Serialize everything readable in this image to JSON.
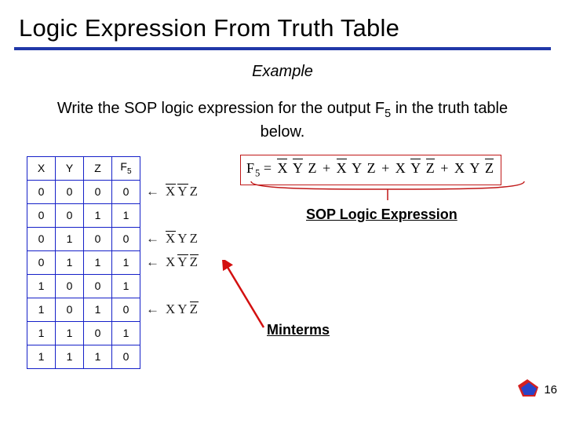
{
  "title": "Logic Expression From Truth Table",
  "example_label": "Example",
  "prompt_before": "Write the SOP logic expression for the output F",
  "prompt_sub": "5",
  "prompt_after": " in the truth table below.",
  "table": {
    "headers": [
      "X",
      "Y",
      "Z",
      "F5"
    ],
    "header_f_base": "F",
    "header_f_sub": "5",
    "rows": [
      [
        "0",
        "0",
        "0",
        "0"
      ],
      [
        "0",
        "0",
        "1",
        "1"
      ],
      [
        "0",
        "1",
        "0",
        "0"
      ],
      [
        "0",
        "1",
        "1",
        "1"
      ],
      [
        "1",
        "0",
        "0",
        "1"
      ],
      [
        "1",
        "0",
        "1",
        "0"
      ],
      [
        "1",
        "1",
        "0",
        "1"
      ],
      [
        "1",
        "1",
        "1",
        "0"
      ]
    ]
  },
  "minterms": {
    "arrow": "←",
    "vars": [
      "X",
      "Y",
      "Z"
    ],
    "items": [
      {
        "active": true,
        "bars": [
          true,
          true,
          false
        ]
      },
      {
        "active": false,
        "bars": []
      },
      {
        "active": true,
        "bars": [
          true,
          false,
          false
        ]
      },
      {
        "active": true,
        "bars": [
          false,
          true,
          true
        ]
      },
      {
        "active": false,
        "bars": []
      },
      {
        "active": true,
        "bars": [
          false,
          false,
          true
        ]
      },
      {
        "active": false,
        "bars": []
      }
    ]
  },
  "formula": {
    "lhs_base": "F",
    "lhs_sub": "5",
    "eq": "=",
    "plus": "+",
    "terms": [
      {
        "bars": [
          true,
          true,
          false
        ]
      },
      {
        "bars": [
          true,
          false,
          false
        ]
      },
      {
        "bars": [
          false,
          true,
          true
        ]
      },
      {
        "bars": [
          false,
          false,
          true
        ]
      }
    ]
  },
  "labels": {
    "sop": "SOP Logic Expression",
    "minterms": "Minterms"
  },
  "page_number": "16"
}
